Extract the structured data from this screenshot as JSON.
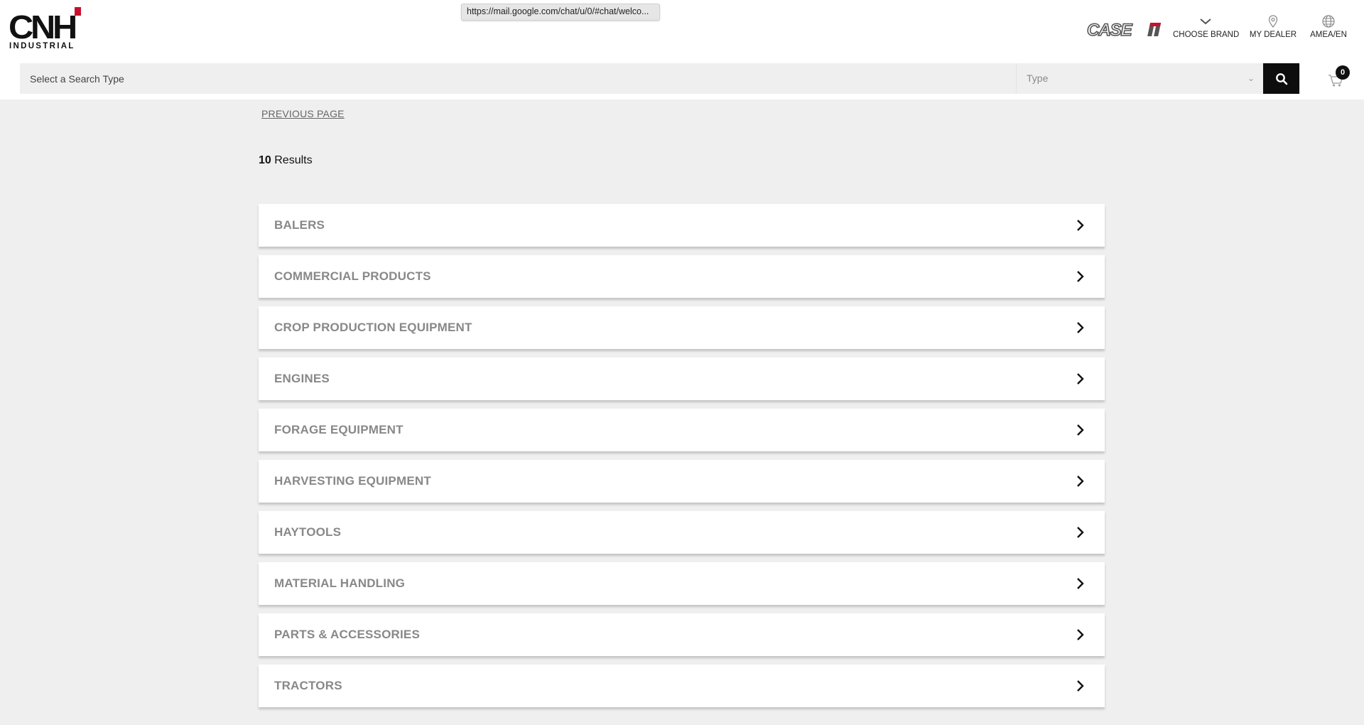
{
  "browser": {
    "status_url": "https://mail.google.com/chat/u/0/#chat/welco..."
  },
  "header": {
    "logo": {
      "main": "CNH",
      "sub": "INDUSTRIAL"
    },
    "brand_logo_text": "CASE IH",
    "nav": {
      "choose_brand": "CHOOSE BRAND",
      "my_dealer": "MY DEALER",
      "region": "AMEA/EN"
    }
  },
  "search": {
    "placeholder": "Select a Search Type",
    "type_placeholder": "Type",
    "cart_count": "0"
  },
  "main": {
    "previous_page": "PREVIOUS PAGE",
    "results_count": "10",
    "results_label": "Results",
    "categories": [
      {
        "label": "BALERS"
      },
      {
        "label": "COMMERCIAL PRODUCTS"
      },
      {
        "label": "CROP PRODUCTION EQUIPMENT"
      },
      {
        "label": "ENGINES"
      },
      {
        "label": "FORAGE EQUIPMENT"
      },
      {
        "label": "HARVESTING EQUIPMENT"
      },
      {
        "label": "HAYTOOLS"
      },
      {
        "label": "MATERIAL HANDLING"
      },
      {
        "label": "PARTS & ACCESSORIES"
      },
      {
        "label": "TRACTORS"
      }
    ]
  },
  "colors": {
    "accent_red": "#c8102e",
    "search_button": "#0d0d0d",
    "page_background": "#efefef",
    "row_label": "#888888"
  }
}
